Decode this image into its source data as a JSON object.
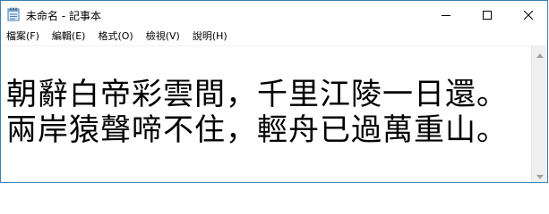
{
  "window": {
    "title": "未命名 - 記事本",
    "icon": "notepad-icon",
    "controls": {
      "minimize": "minimize-icon",
      "maximize": "maximize-icon",
      "close": "close-icon"
    }
  },
  "menubar": {
    "items": [
      {
        "label": "檔案(F)"
      },
      {
        "label": "編輯(E)"
      },
      {
        "label": "格式(O)"
      },
      {
        "label": "檢視(V)"
      },
      {
        "label": "說明(H)"
      }
    ]
  },
  "editor": {
    "lines": [
      "朝辭白帝彩雲間，千里江陵一日還。",
      "兩岸猿聲啼不住，輕舟已過萬重山。"
    ]
  },
  "colors": {
    "border": "#3c7fb1",
    "scrollbar": "#f0f0f0",
    "text": "#000000"
  }
}
